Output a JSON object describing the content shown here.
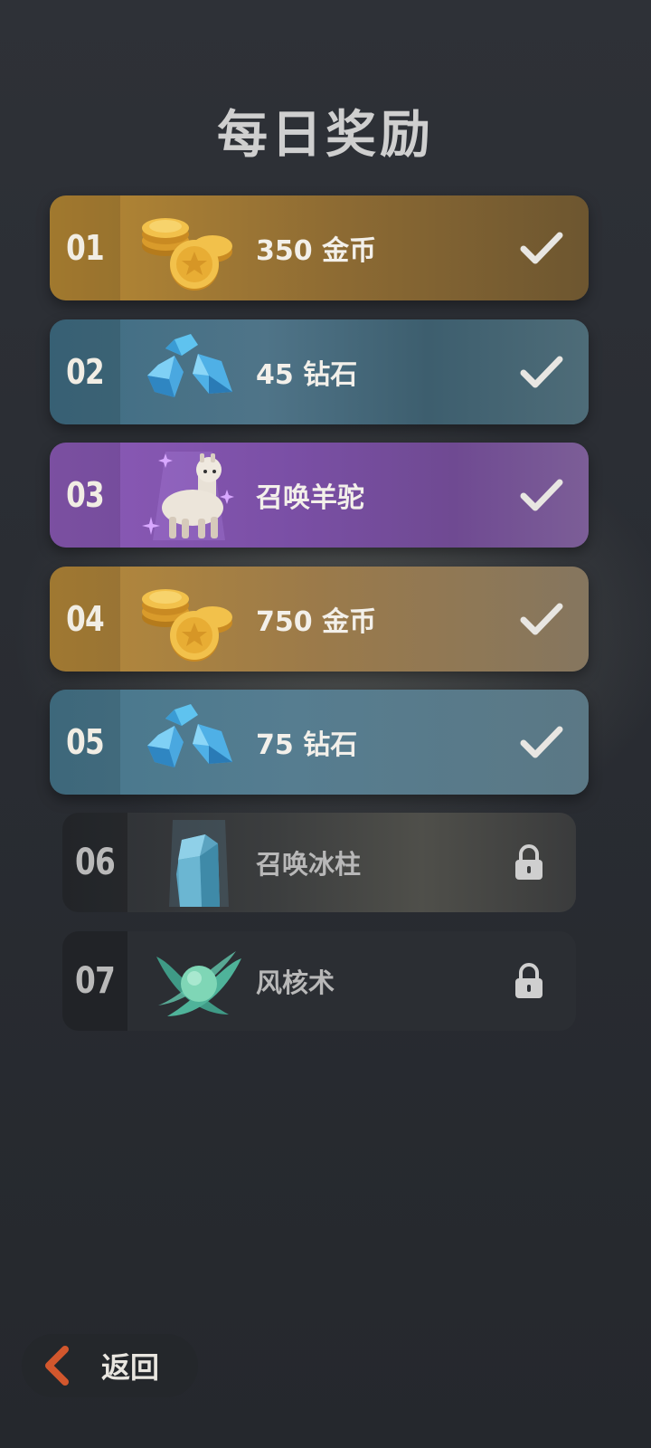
{
  "page": {
    "title": "每日奖励"
  },
  "rewards": [
    {
      "day": "01",
      "label": "350 金币",
      "icon": "gold-coins-icon",
      "status": "claimed"
    },
    {
      "day": "02",
      "label": "45 钻石",
      "icon": "diamonds-icon",
      "status": "claimed"
    },
    {
      "day": "03",
      "label": "召唤羊驼",
      "icon": "alpaca-icon",
      "status": "claimed"
    },
    {
      "day": "04",
      "label": "750 金币",
      "icon": "gold-coins-icon",
      "status": "claimed"
    },
    {
      "day": "05",
      "label": "75 钻石",
      "icon": "diamonds-icon",
      "status": "claimed"
    },
    {
      "day": "06",
      "label": "召唤冰柱",
      "icon": "ice-pillar-icon",
      "status": "locked"
    },
    {
      "day": "07",
      "label": "风核术",
      "icon": "wind-core-icon",
      "status": "locked"
    }
  ],
  "colors": {
    "gold": "#b88a35",
    "diamond": "#3f6e84",
    "summon": "#8c5bb8",
    "locked": "#2b2e33",
    "back_chevron": "#d2572d"
  },
  "footer": {
    "back_label": "返回"
  }
}
